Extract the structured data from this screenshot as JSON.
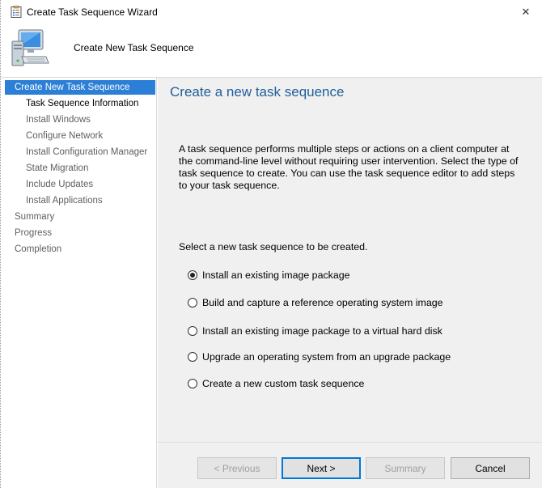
{
  "window": {
    "title": "Create Task Sequence Wizard",
    "close_symbol": "✕"
  },
  "header": {
    "title": "Create New Task Sequence",
    "icon": "computer-icon"
  },
  "nav": {
    "items": [
      {
        "label": "Create New Task Sequence",
        "state": "active"
      },
      {
        "label": "Task Sequence Information",
        "state": "current"
      },
      {
        "label": "Install Windows",
        "state": "normal"
      },
      {
        "label": "Configure Network",
        "state": "normal"
      },
      {
        "label": "Install Configuration Manager",
        "state": "normal"
      },
      {
        "label": "State Migration",
        "state": "normal"
      },
      {
        "label": "Include Updates",
        "state": "normal"
      },
      {
        "label": "Install Applications",
        "state": "normal"
      },
      {
        "label": "Summary",
        "state": "normal"
      },
      {
        "label": "Progress",
        "state": "normal"
      },
      {
        "label": "Completion",
        "state": "normal"
      }
    ]
  },
  "main": {
    "title": "Create a new task sequence",
    "description": "A task sequence performs multiple steps or actions on a client computer at the command-line level without requiring user intervention. Select the type of task sequence to create. You can use the task sequence editor to add steps to your task sequence.",
    "select_label": "Select a new task sequence to be created.",
    "options": [
      {
        "label": "Install an existing image package",
        "checked": true
      },
      {
        "label": "Build and capture a reference operating system image",
        "checked": false
      },
      {
        "label": "Install an existing image package to a virtual hard disk",
        "checked": false
      },
      {
        "label": "Upgrade an operating system from an upgrade package",
        "checked": false
      },
      {
        "label": "Create a new custom task sequence",
        "checked": false
      }
    ]
  },
  "footer": {
    "previous": "< Previous",
    "next": "Next >",
    "summary": "Summary",
    "cancel": "Cancel"
  },
  "colors": {
    "accent": "#2b7fd6",
    "title_blue": "#1f5f99"
  }
}
